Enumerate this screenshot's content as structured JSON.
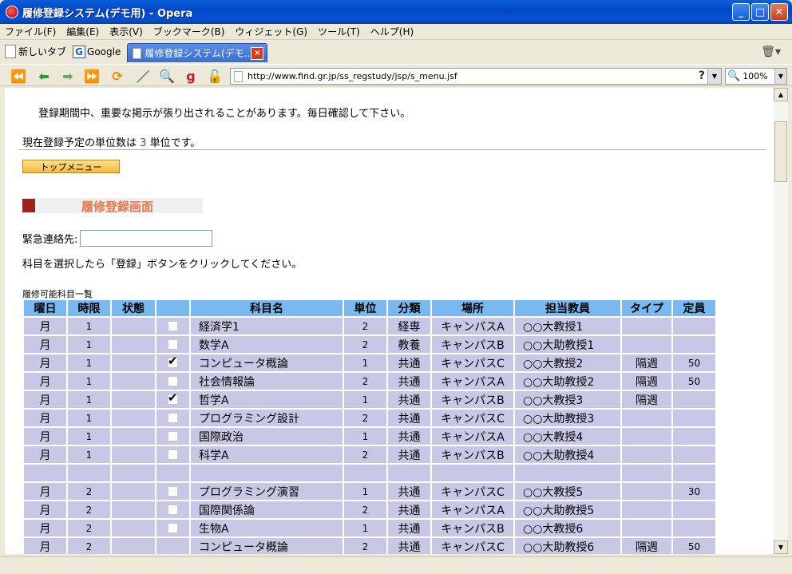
{
  "window": {
    "title": "履修登録システム(デモ用) - Opera"
  },
  "menu": [
    "ファイル(F)",
    "編集(E)",
    "表示(V)",
    "ブックマーク(B)",
    "ウィジェット(G)",
    "ツール(T)",
    "ヘルプ(H)"
  ],
  "tabs": {
    "new_tab": "新しいタブ",
    "google": "Google",
    "active": "履修登録システム(デモ..."
  },
  "address": {
    "url": "http://www.find.gr.jp/ss_regstudy/jsp/s_menu.jsf",
    "zoom": "100%"
  },
  "page": {
    "notice": "登録期間中、重要な掲示が張り出されることがあります。毎日確認して下さい。",
    "units_prefix": "現在登録予定の単位数は",
    "units_value": "3",
    "units_suffix": "単位です。",
    "top_menu_button": "トップメニュー",
    "heading": "履修登録画面",
    "contact_label": "緊急連絡先:",
    "instruction": "科目を選択したら「登録」ボタンをクリックしてください。",
    "caption": "履修可能科目一覧"
  },
  "table": {
    "headers": [
      "曜日",
      "時限",
      "状態",
      "",
      "科目名",
      "単位",
      "分類",
      "場所",
      "担当教員",
      "タイプ",
      "定員"
    ],
    "rows": [
      {
        "day": "月",
        "period": "1",
        "status": "",
        "checked": false,
        "show_cb": true,
        "name": "経済学1",
        "units": "2",
        "cat": "経専",
        "place": "キャンパスA",
        "teacher": "○○大教授1",
        "type": "",
        "cap": ""
      },
      {
        "day": "月",
        "period": "1",
        "status": "",
        "checked": false,
        "show_cb": true,
        "name": "数学A",
        "units": "2",
        "cat": "教養",
        "place": "キャンパスB",
        "teacher": "○○大助教授1",
        "type": "",
        "cap": ""
      },
      {
        "day": "月",
        "period": "1",
        "status": "",
        "checked": true,
        "show_cb": true,
        "name": "コンピュータ概論",
        "units": "1",
        "cat": "共通",
        "place": "キャンパスC",
        "teacher": "○○大教授2",
        "type": "隔週",
        "cap": "50"
      },
      {
        "day": "月",
        "period": "1",
        "status": "",
        "checked": false,
        "show_cb": true,
        "name": "社会情報論",
        "units": "2",
        "cat": "共通",
        "place": "キャンパスA",
        "teacher": "○○大助教授2",
        "type": "隔週",
        "cap": "50"
      },
      {
        "day": "月",
        "period": "1",
        "status": "",
        "checked": true,
        "show_cb": true,
        "name": "哲学A",
        "units": "1",
        "cat": "共通",
        "place": "キャンパスB",
        "teacher": "○○大教授3",
        "type": "隔週",
        "cap": ""
      },
      {
        "day": "月",
        "period": "1",
        "status": "",
        "checked": false,
        "show_cb": true,
        "name": "プログラミング設計",
        "units": "2",
        "cat": "共通",
        "place": "キャンパスC",
        "teacher": "○○大助教授3",
        "type": "",
        "cap": ""
      },
      {
        "day": "月",
        "period": "1",
        "status": "",
        "checked": false,
        "show_cb": true,
        "name": "国際政治",
        "units": "1",
        "cat": "共通",
        "place": "キャンパスA",
        "teacher": "○○大教授4",
        "type": "",
        "cap": ""
      },
      {
        "day": "月",
        "period": "1",
        "status": "",
        "checked": false,
        "show_cb": true,
        "name": "科学A",
        "units": "2",
        "cat": "共通",
        "place": "キャンパスB",
        "teacher": "○○大助教授4",
        "type": "",
        "cap": ""
      },
      {
        "day": "",
        "period": "",
        "status": "",
        "checked": false,
        "show_cb": false,
        "name": "",
        "units": "",
        "cat": "",
        "place": "",
        "teacher": "",
        "type": "",
        "cap": ""
      },
      {
        "day": "月",
        "period": "2",
        "status": "",
        "checked": false,
        "show_cb": true,
        "name": "プログラミング演習",
        "units": "1",
        "cat": "共通",
        "place": "キャンパスC",
        "teacher": "○○大教授5",
        "type": "",
        "cap": "30"
      },
      {
        "day": "月",
        "period": "2",
        "status": "",
        "checked": false,
        "show_cb": true,
        "name": "国際関係論",
        "units": "2",
        "cat": "共通",
        "place": "キャンパスA",
        "teacher": "○○大助教授5",
        "type": "",
        "cap": ""
      },
      {
        "day": "月",
        "period": "2",
        "status": "",
        "checked": false,
        "show_cb": true,
        "name": "生物A",
        "units": "1",
        "cat": "共通",
        "place": "キャンパスB",
        "teacher": "○○大教授6",
        "type": "",
        "cap": ""
      },
      {
        "day": "月",
        "period": "2",
        "status": "",
        "checked": false,
        "show_cb": false,
        "name": "コンピュータ概論",
        "units": "2",
        "cat": "共通",
        "place": "キャンパスC",
        "teacher": "○○大助教授6",
        "type": "隔週",
        "cap": "50"
      }
    ]
  },
  "icons": [
    "back-icon",
    "forward-icon",
    "fast-forward-icon",
    "reload-icon",
    "edit-icon",
    "search-icon",
    "gadget-icon",
    "lock-icon",
    "trash-icon"
  ]
}
